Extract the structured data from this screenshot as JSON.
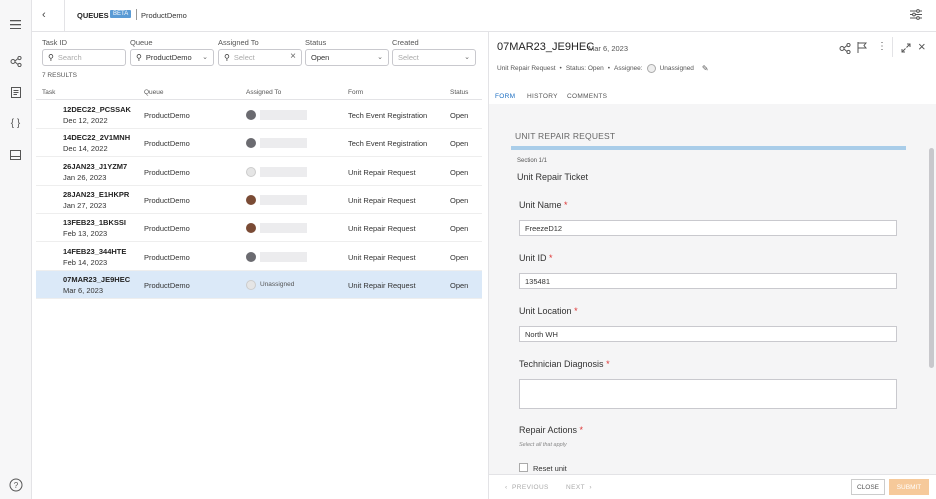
{
  "header": {
    "section": "QUEUES",
    "beta": "BETA",
    "crumb": "ProductDemo"
  },
  "filters": {
    "task_id": {
      "label": "Task ID",
      "placeholder": "Search"
    },
    "queue": {
      "label": "Queue",
      "value": "ProductDemo"
    },
    "assigned": {
      "label": "Assigned To",
      "placeholder": "Select"
    },
    "status": {
      "label": "Status",
      "value": "Open"
    },
    "created": {
      "label": "Created",
      "placeholder": "Select"
    }
  },
  "results": "7 RESULTS",
  "columns": {
    "task": "Task",
    "queue": "Queue",
    "assigned": "Assigned To",
    "form": "Form",
    "status": "Status"
  },
  "rows": [
    {
      "id": "12DEC22_PCSSAK",
      "date": "Dec 12, 2022",
      "queue": "ProductDemo",
      "form": "Tech Event Registration",
      "status": "Open"
    },
    {
      "id": "14DEC22_2V1MNH",
      "date": "Dec 14, 2022",
      "queue": "ProductDemo",
      "form": "Tech Event Registration",
      "status": "Open"
    },
    {
      "id": "26JAN23_J1YZM7",
      "date": "Jan 26, 2023",
      "queue": "ProductDemo",
      "form": "Unit Repair Request",
      "status": "Open"
    },
    {
      "id": "28JAN23_E1HKPR",
      "date": "Jan 27, 2023",
      "queue": "ProductDemo",
      "form": "Unit Repair Request",
      "status": "Open"
    },
    {
      "id": "13FEB23_1BKSSI",
      "date": "Feb 13, 2023",
      "queue": "ProductDemo",
      "form": "Unit Repair Request",
      "status": "Open"
    },
    {
      "id": "14FEB23_344HTE",
      "date": "Feb 14, 2023",
      "queue": "ProductDemo",
      "form": "Unit Repair Request",
      "status": "Open"
    },
    {
      "id": "07MAR23_JE9HEC",
      "date": "Mar 6, 2023",
      "queue": "ProductDemo",
      "assigned": "Unassigned",
      "form": "Unit Repair Request",
      "status": "Open"
    }
  ],
  "detail": {
    "title": "07MAR23_JE9HEC",
    "date": "Mar 6, 2023",
    "form_name": "Unit Repair Request",
    "status": "Status: Open",
    "assignee_label": "Assignee:",
    "assignee": "Unassigned",
    "tabs": [
      "FORM",
      "HISTORY",
      "COMMENTS"
    ]
  },
  "form": {
    "title": "UNIT REPAIR REQUEST",
    "section": "Section 1/1",
    "heading": "Unit Repair Ticket",
    "unit_name_label": "Unit Name",
    "unit_name": "FreezeD12",
    "unit_id_label": "Unit ID",
    "unit_id": "135481",
    "unit_location_label": "Unit Location",
    "unit_location": "North WH",
    "diagnosis_label": "Technician Diagnosis",
    "repair_label": "Repair Actions",
    "repair_hint": "Select all that apply",
    "reset_unit": "Reset unit",
    "required_mark": "*"
  },
  "footer": {
    "previous": "PREVIOUS",
    "next": "NEXT",
    "close": "CLOSE",
    "submit": "SUBMIT"
  },
  "colors": {
    "accent": "#1b6ec2",
    "selected_row": "#dbe9f8",
    "progress": "#a9cde9",
    "submit": "#f6c99a"
  }
}
